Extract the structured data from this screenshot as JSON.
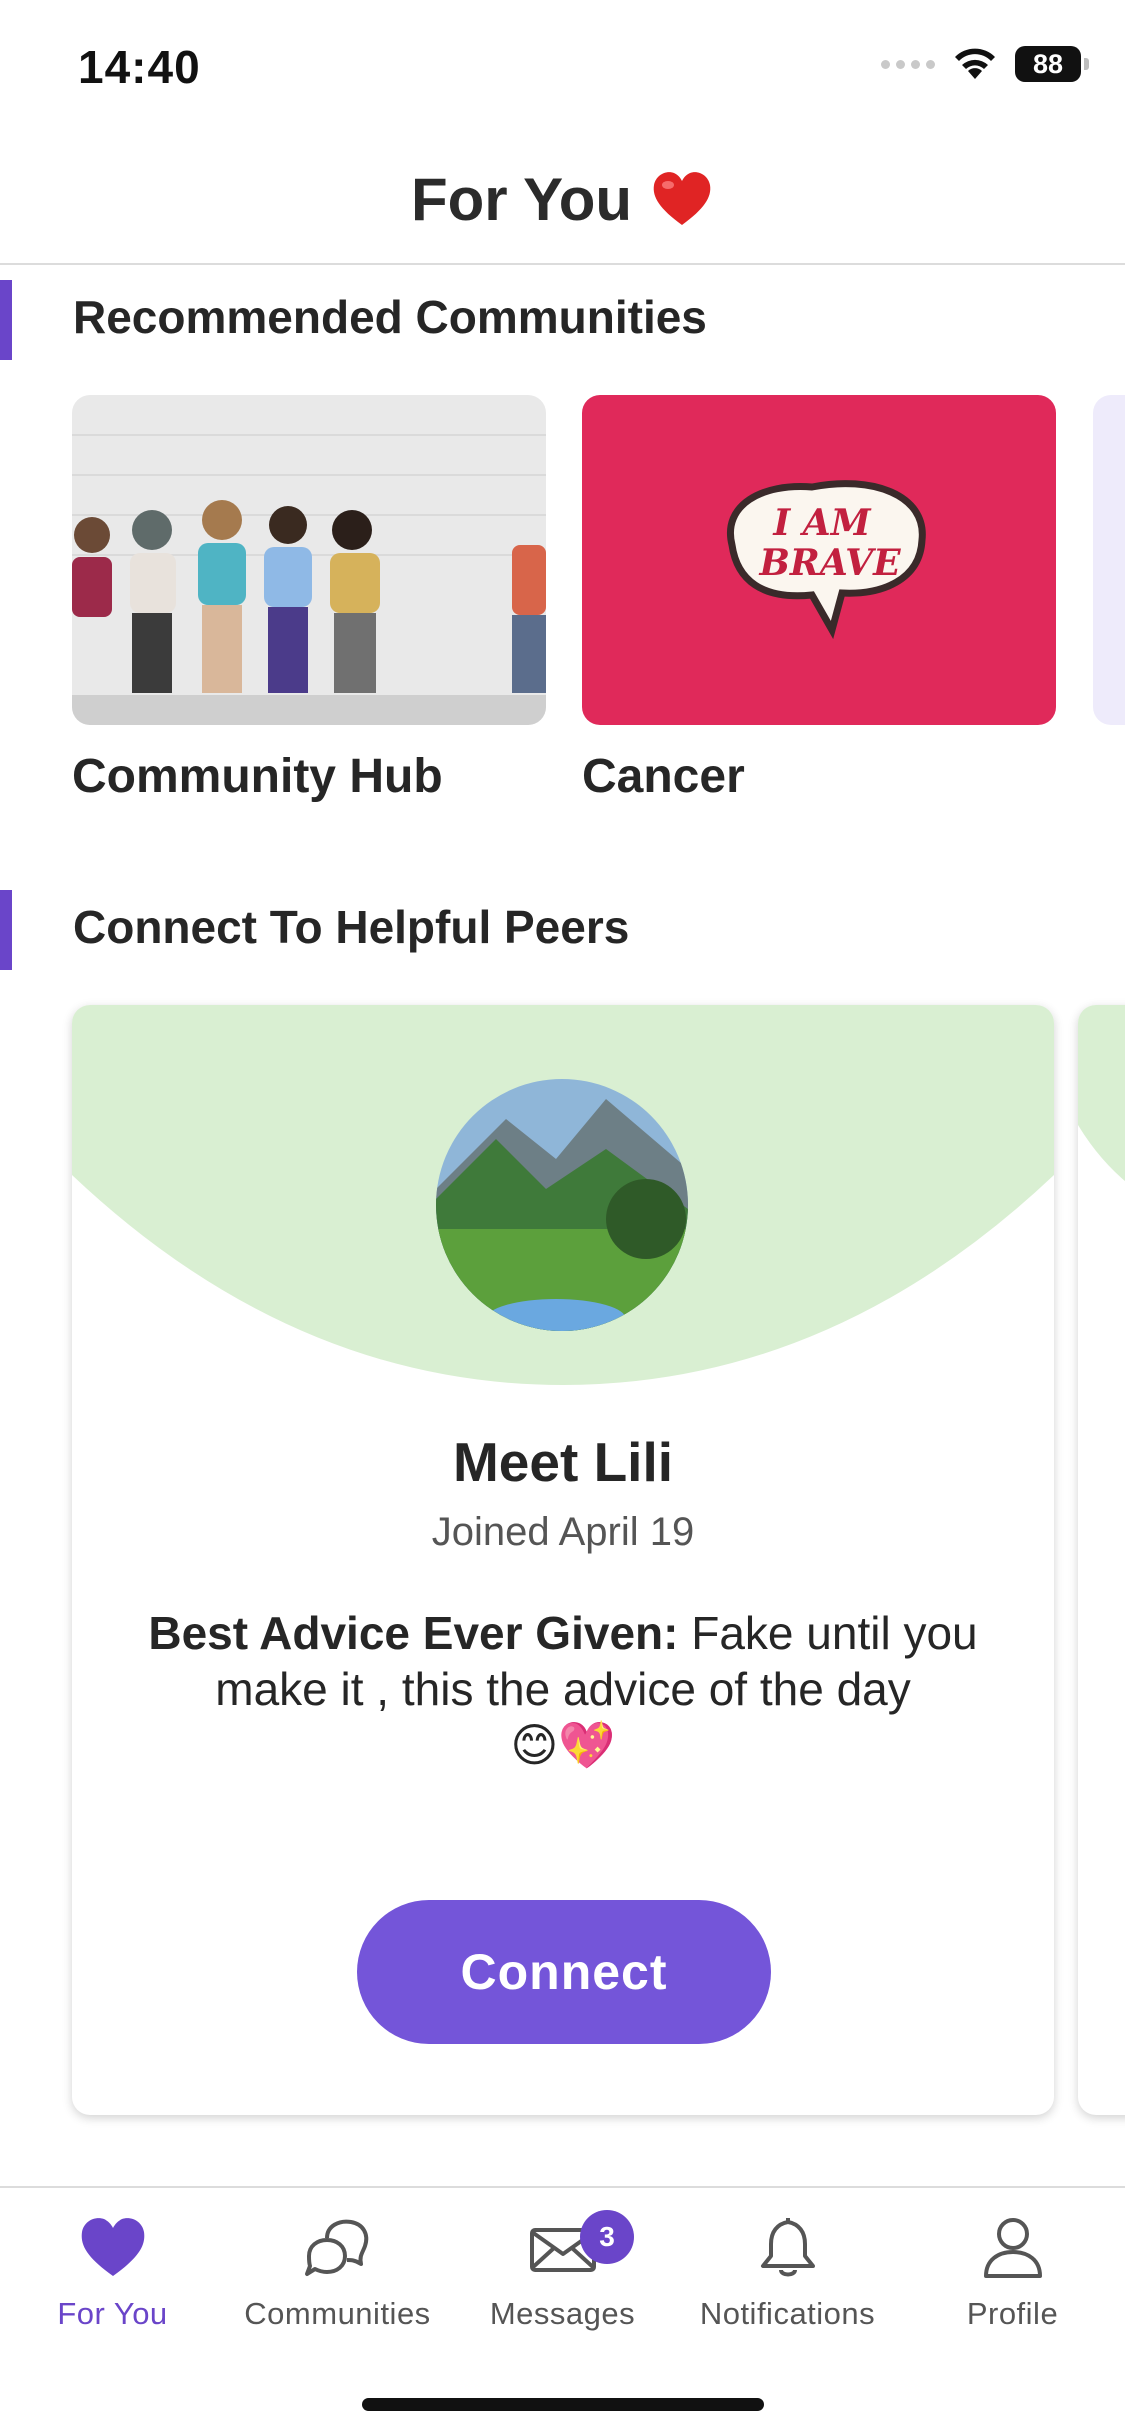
{
  "status_bar": {
    "time": "14:40",
    "battery": "88"
  },
  "header": {
    "title": "For You"
  },
  "sections": {
    "recommended_title": "Recommended Communities",
    "peers_title": "Connect To Helpful Peers"
  },
  "communities": [
    {
      "name": "Community Hub"
    },
    {
      "name": "Cancer",
      "pin_text_line1": "I AM",
      "pin_text_line2": "BRAVE"
    }
  ],
  "peer": {
    "name": "Meet Lili",
    "joined": "Joined April 19",
    "advice_label": "Best Advice Ever Given:",
    "advice_text": "Fake until you make it , this the advice of the day",
    "advice_emojis": "😊💖",
    "connect_label": "Connect"
  },
  "tabs": [
    {
      "label": "For You",
      "icon": "heart-icon",
      "active": true
    },
    {
      "label": "Communities",
      "icon": "chat-bubbles-icon"
    },
    {
      "label": "Messages",
      "icon": "envelope-icon",
      "badge": "3"
    },
    {
      "label": "Notifications",
      "icon": "bell-icon"
    },
    {
      "label": "Profile",
      "icon": "person-icon"
    }
  ],
  "colors": {
    "accent": "#6a45c9",
    "button": "#7455d9",
    "peer_arc": "#d9efd2",
    "cancer_bg": "#e0295a"
  }
}
